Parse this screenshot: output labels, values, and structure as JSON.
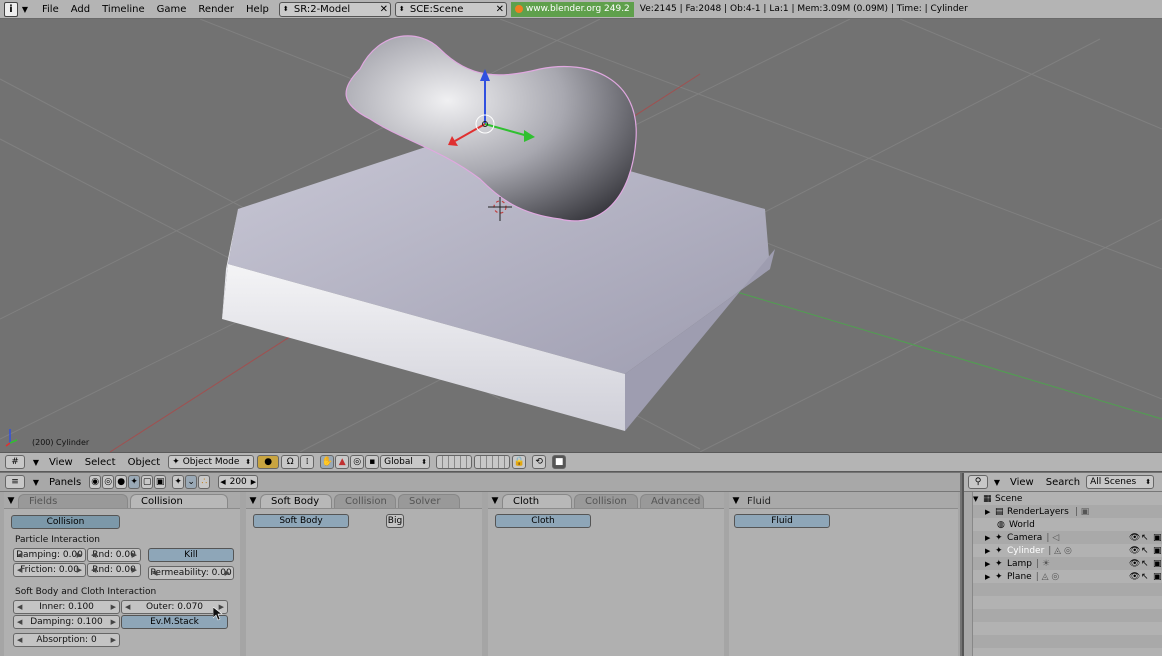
{
  "topbar": {
    "menus": [
      "File",
      "Add",
      "Timeline",
      "Game",
      "Render",
      "Help"
    ],
    "screen": "SR:2-Model",
    "scene": "SCE:Scene",
    "url": "www.blender.org 249.2",
    "stats": "Ve:2145 | Fa:2048 | Ob:4-1 | La:1  | Mem:3.09M (0.09M)  | Time: | Cylinder"
  },
  "viewport": {
    "object_label": "(200) Cylinder"
  },
  "viewbar": {
    "menus": [
      "View",
      "Select",
      "Object"
    ],
    "mode": "Object Mode",
    "orientation": "Global"
  },
  "propbar": {
    "panels_label": "Panels",
    "frame": "200"
  },
  "panel1": {
    "tabs": [
      "Fields",
      "Collision"
    ],
    "collision_btn": "Collision",
    "particle_heading": "Particle Interaction",
    "damping": "Damping: 0.00",
    "rnd1": "Rnd: 0.00",
    "friction": "Friction: 0.00",
    "rnd2": "Rnd: 0.00",
    "kill": "Kill",
    "permeability": "Permeability: 0.00",
    "soft_heading": "Soft Body and Cloth Interaction",
    "inner": "Inner: 0.100",
    "outer": "Outer: 0.070",
    "damping2": "Damping: 0.100",
    "evmstack": "Ev.M.Stack",
    "absorption": "Absorption: 0"
  },
  "panel2": {
    "tabs": [
      "Soft Body",
      "Collision",
      "Solver"
    ],
    "softbody_btn": "Soft Body",
    "big_btn": "Big"
  },
  "panel3": {
    "tabs": [
      "Cloth",
      "Collision",
      "Advanced"
    ],
    "cloth_btn": "Cloth"
  },
  "panel4": {
    "tabs": [
      "Fluid"
    ],
    "fluid_btn": "Fluid"
  },
  "outliner": {
    "menus": [
      "View",
      "Search"
    ],
    "scenes": "All Scenes",
    "items": [
      "Scene",
      "RenderLayers",
      "World",
      "Camera",
      "Cylinder",
      "Lamp",
      "Plane"
    ]
  }
}
